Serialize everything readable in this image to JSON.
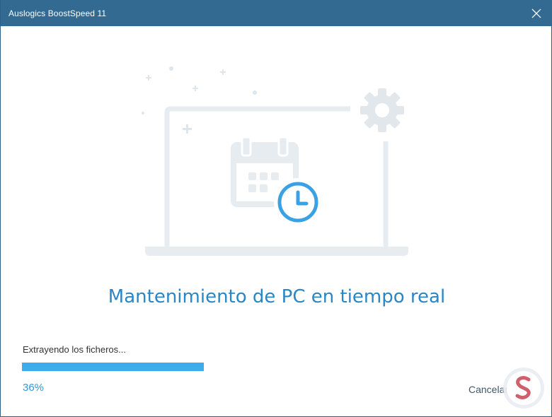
{
  "window": {
    "title": "Auslogics BoostSpeed 11",
    "close_icon": "close-icon"
  },
  "colors": {
    "titlebar": "#326a92",
    "accent": "#2b86c6",
    "progress": "#3aaee8",
    "illustration": "#e6ecf0",
    "clock": "#3aa1e4"
  },
  "illustration": {
    "icons": [
      "laptop-icon",
      "calendar-icon",
      "clock-icon",
      "gear-icon",
      "sparkle-icon"
    ]
  },
  "main": {
    "heading": "Mantenimiento de PC en tiempo real"
  },
  "progress": {
    "status": "Extrayendo los ficheros...",
    "percent_label": "36%",
    "value": 0.36
  },
  "footer": {
    "cancel_label": "Cancelar"
  }
}
